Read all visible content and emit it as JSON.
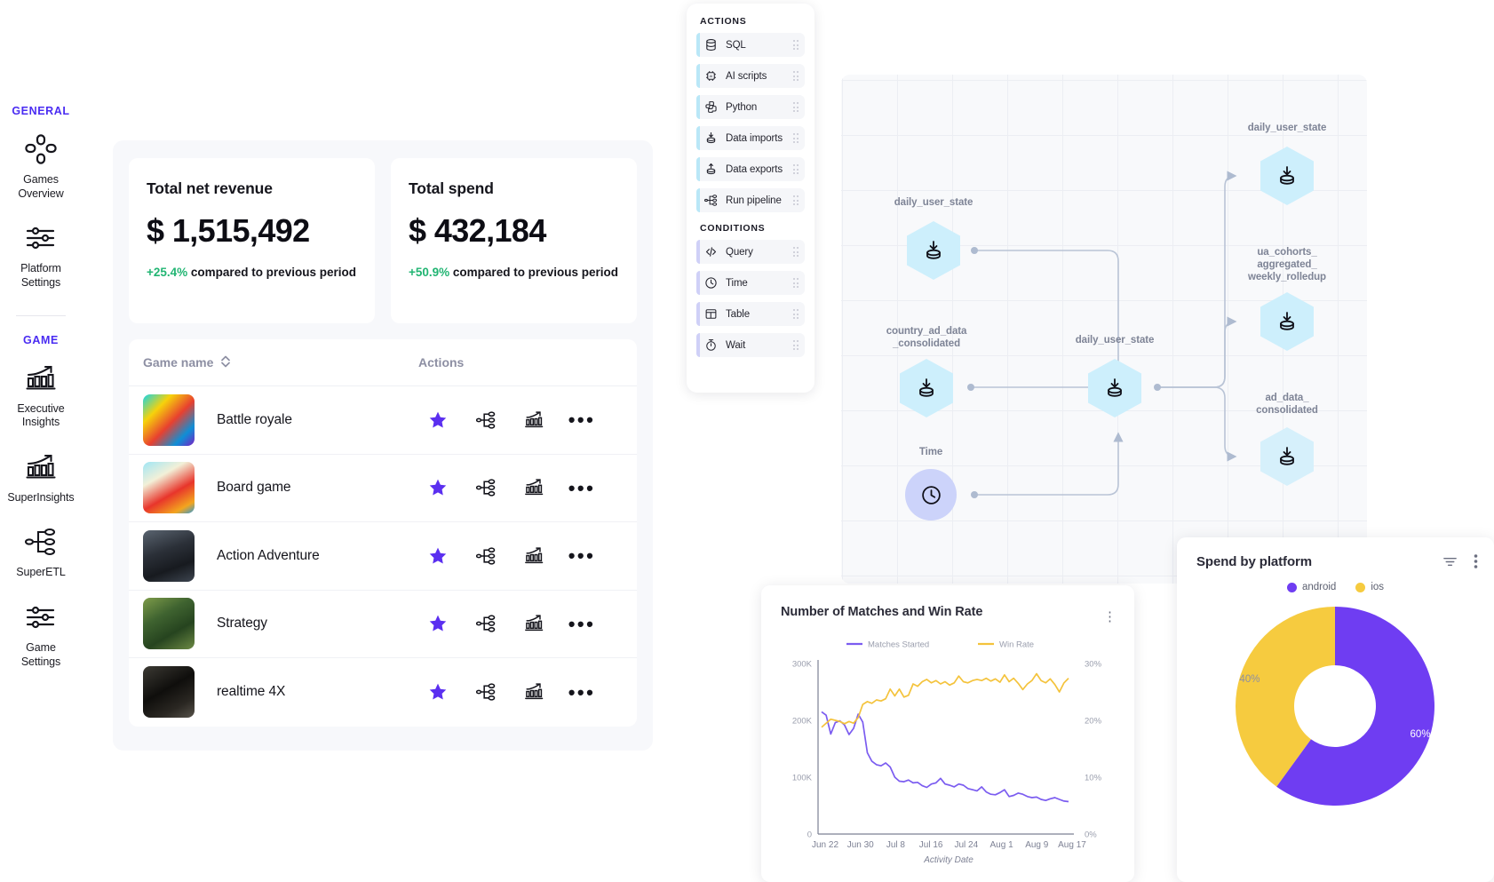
{
  "sidebar": {
    "groups": [
      {
        "label": "GENERAL",
        "items": [
          {
            "label": "Games\nOverview",
            "icon": "gamepad-dpad-icon"
          },
          {
            "label": "Platform\nSettings",
            "icon": "sliders-icon"
          }
        ]
      },
      {
        "label": "GAME",
        "items": [
          {
            "label": "Executive\nInsights",
            "icon": "bar-chart-up-icon"
          },
          {
            "label": "SuperInsights",
            "icon": "bar-chart-up-icon"
          },
          {
            "label": "SuperETL",
            "icon": "pipeline-tree-icon"
          },
          {
            "label": "Game\nSettings",
            "icon": "sliders-icon"
          }
        ]
      }
    ]
  },
  "dashboard": {
    "kpis": [
      {
        "title": "Total net revenue",
        "value": "$ 1,515,492",
        "delta": "+25.4%",
        "delta_suffix": " compared to previous period"
      },
      {
        "title": "Total spend",
        "value": "$ 432,184",
        "delta": "+50.9%",
        "delta_suffix": " compared to previous period"
      }
    ],
    "table": {
      "columns": [
        "Game name",
        "Actions"
      ],
      "rows": [
        {
          "name": "Battle royale",
          "thumb": "battle-royale-art"
        },
        {
          "name": "Board game",
          "thumb": "board-game-art"
        },
        {
          "name": "Action Adventure",
          "thumb": "action-adventure-art"
        },
        {
          "name": "Strategy",
          "thumb": "strategy-art"
        },
        {
          "name": "realtime 4X",
          "thumb": "realtime-4x-art"
        }
      ],
      "row_actions": [
        "favorite-star-icon",
        "share-pipeline-icon",
        "insights-chart-icon",
        "more-options-icon"
      ]
    }
  },
  "palette": {
    "sections": [
      {
        "label": "ACTIONS",
        "accent": "#b9e7f7",
        "items": [
          {
            "label": "SQL",
            "icon": "database-icon"
          },
          {
            "label": "AI scripts",
            "icon": "ai-chip-icon"
          },
          {
            "label": "Python",
            "icon": "python-icon"
          },
          {
            "label": "Data imports",
            "icon": "data-import-icon"
          },
          {
            "label": "Data exports",
            "icon": "data-export-icon"
          },
          {
            "label": "Run pipeline",
            "icon": "run-pipeline-icon"
          }
        ]
      },
      {
        "label": "CONDITIONS",
        "accent": "#cfd0f7",
        "items": [
          {
            "label": "Query",
            "icon": "code-brackets-icon"
          },
          {
            "label": "Time",
            "icon": "clock-icon"
          },
          {
            "label": "Table",
            "icon": "table-icon"
          },
          {
            "label": "Wait",
            "icon": "stopwatch-icon"
          }
        ]
      }
    ]
  },
  "dag": {
    "nodes": [
      {
        "id": "n1",
        "label": "daily_user_state",
        "shape": "hex",
        "icon": "data-import-icon",
        "selected": false
      },
      {
        "id": "n2",
        "label": "country_ad_data\n_consolidated",
        "shape": "hex",
        "icon": "data-import-icon",
        "selected": false
      },
      {
        "id": "n3",
        "label": "Time",
        "shape": "circle",
        "icon": "clock-icon",
        "selected": false
      },
      {
        "id": "n4",
        "label": "daily_user_state",
        "shape": "hex",
        "icon": "data-import-icon",
        "selected": false
      },
      {
        "id": "n5",
        "label": "daily_user_state",
        "shape": "hex",
        "icon": "data-import-icon",
        "selected": false
      },
      {
        "id": "n6",
        "label": "ua_cohorts_\naggregated_\nweekly_rolledup",
        "shape": "hex",
        "icon": "data-import-icon",
        "selected": false
      },
      {
        "id": "n7",
        "label": "ad_data_\nconsolidated",
        "shape": "hex",
        "icon": "data-import-icon",
        "selected": true
      }
    ]
  },
  "line_card": {
    "title": "Number of Matches and Win Rate",
    "kebab": "more-options-icon"
  },
  "donut_card": {
    "title": "Spend by platform",
    "filter_icon": "filter-icon",
    "kebab_icon": "more-options-icon"
  },
  "chart_data": [
    {
      "type": "line",
      "title": "Number of Matches and Win Rate",
      "xlabel": "Activity Date",
      "ylabel": "",
      "grid": false,
      "legend_position": "top",
      "x_ticks": [
        "Jun 22",
        "Jun 30",
        "Jul 8",
        "Jul 16",
        "Jul 24",
        "Aug 1",
        "Aug 9",
        "Aug 17"
      ],
      "y_left_ticks": [
        "0",
        "100K",
        "200K",
        "300K"
      ],
      "y_left_lim": [
        0,
        300000
      ],
      "y_right_ticks": [
        "0%",
        "10%",
        "20%",
        "30%"
      ],
      "y_right_lim": [
        0,
        30
      ],
      "series": [
        {
          "name": "Matches Started",
          "color": "#7b5cf0",
          "axis": "left",
          "values": [
            215000,
            209000,
            176000,
            196000,
            199000,
            192000,
            175000,
            186000,
            211000,
            197000,
            143000,
            128000,
            122000,
            120000,
            125000,
            118000,
            100000,
            93000,
            92000,
            95000,
            90000,
            91000,
            85000,
            82000,
            88000,
            90000,
            98000,
            88000,
            86000,
            83000,
            88000,
            86000,
            80000,
            78000,
            76000,
            83000,
            74000,
            70000,
            69000,
            73000,
            78000,
            66000,
            68000,
            72000,
            70000,
            66000,
            64000,
            65000,
            61000,
            59000,
            62000,
            64000,
            61000,
            58000,
            57000
          ]
        },
        {
          "name": "Win Rate",
          "color": "#f4c33c",
          "axis": "right",
          "values": [
            18.8,
            19.5,
            20.2,
            20.0,
            19.8,
            19.4,
            19.8,
            19.5,
            20.5,
            22.8,
            23.3,
            23.0,
            23.6,
            23.4,
            23.8,
            25.5,
            24.3,
            25.5,
            24.1,
            24.4,
            26.4,
            26.0,
            26.8,
            27.2,
            26.6,
            27.0,
            26.4,
            26.8,
            26.2,
            26.6,
            27.8,
            26.8,
            26.6,
            27.0,
            27.2,
            27.0,
            27.4,
            26.9,
            27.3,
            26.7,
            28.0,
            26.8,
            27.4,
            26.5,
            25.4,
            26.4,
            27.0,
            28.2,
            27.0,
            26.6,
            27.3,
            26.3,
            25.0,
            26.6,
            27.4
          ]
        }
      ]
    },
    {
      "type": "pie",
      "title": "Spend by platform",
      "legend_position": "top",
      "labels": [
        "android",
        "ios"
      ],
      "values": [
        60,
        40
      ],
      "value_labels": [
        "60%",
        "40%"
      ],
      "colors": [
        "#6f3df2",
        "#f6cb3f"
      ]
    }
  ]
}
